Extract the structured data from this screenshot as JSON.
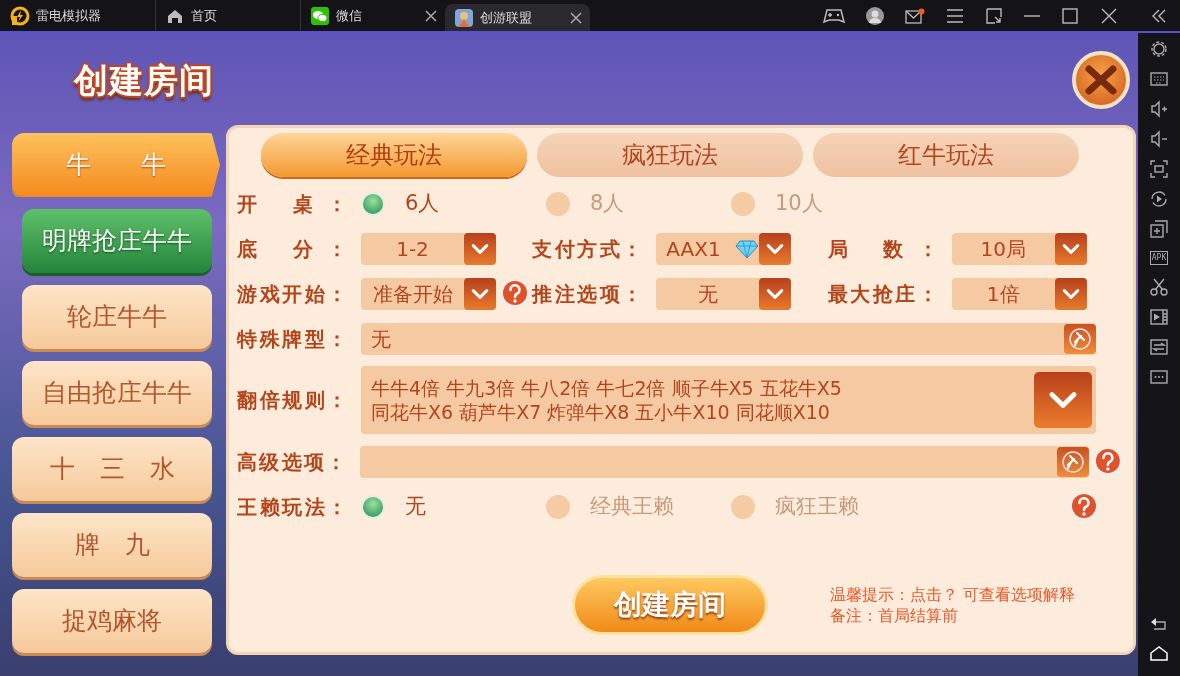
{
  "titlebar": {
    "app_name": "雷电模拟器",
    "mail_unread": true,
    "tabs": [
      {
        "label": "首页",
        "kind": "home",
        "selected": false,
        "closable": false
      },
      {
        "label": "微信",
        "kind": "chat",
        "selected": false,
        "closable": true
      },
      {
        "label": "创游联盟",
        "kind": "game",
        "selected": true,
        "closable": true
      }
    ]
  },
  "side_tools": [
    {
      "kind": "settings"
    },
    {
      "kind": "keyboard"
    },
    {
      "kind": "volup"
    },
    {
      "kind": "voldown"
    },
    {
      "kind": "screen"
    },
    {
      "kind": "rotate"
    },
    {
      "kind": "addwin"
    },
    {
      "kind": "apk",
      "label": "APK"
    },
    {
      "kind": "cut"
    },
    {
      "kind": "video"
    },
    {
      "kind": "sync"
    },
    {
      "kind": "more"
    },
    {
      "kind": "gap"
    },
    {
      "kind": "back"
    },
    {
      "kind": "home"
    }
  ],
  "dialog": {
    "title": "创建房间"
  },
  "games": [
    {
      "label": "牛　　牛",
      "selected": true,
      "children": [
        {
          "label": "明牌抢庄牛牛",
          "selected": true
        },
        {
          "label": "轮庄牛牛",
          "selected": false
        },
        {
          "label": "自由抢庄牛牛",
          "selected": false
        }
      ]
    },
    {
      "label": "十　三　水",
      "selected": false
    },
    {
      "label": "牌　九",
      "selected": false
    },
    {
      "label": "捉鸡麻将",
      "selected": false
    }
  ],
  "mode_tabs": [
    {
      "label": "经典玩法",
      "selected": true
    },
    {
      "label": "疯狂玩法",
      "selected": false
    },
    {
      "label": "红牛玩法",
      "selected": false
    }
  ],
  "seat_row": {
    "label": "开 桌：",
    "options": [
      {
        "label": "6人",
        "selected": true
      },
      {
        "label": "8人",
        "selected": false
      },
      {
        "label": "10人",
        "selected": false
      }
    ]
  },
  "select_rows": [
    [
      {
        "label": "底 分：",
        "value": "1-2",
        "kind": "plain"
      },
      {
        "label": "支付方式：",
        "value": "AAX1",
        "kind": "diamond"
      },
      {
        "label": "局 数：",
        "value": "10局",
        "kind": "plain"
      }
    ],
    [
      {
        "label": "游戏开始：",
        "value": "准备开始",
        "kind": "help"
      },
      {
        "label": "推注选项：",
        "value": "无",
        "kind": "plain"
      },
      {
        "label": "最大抢庄：",
        "value": "1倍",
        "kind": "plain"
      }
    ]
  ],
  "special": {
    "label": "特殊牌型：",
    "value": "无"
  },
  "double": {
    "label": "翻倍规则：",
    "lines": [
      "牛牛4倍 牛九3倍 牛八2倍 牛七2倍 顺子牛X5 五花牛X5",
      "同花牛X6 葫芦牛X7 炸弹牛X8 五小牛X10 同花顺X10"
    ]
  },
  "advanced": {
    "label": "高级选项："
  },
  "wild": {
    "label": "王赖玩法：",
    "options": [
      {
        "label": "无",
        "selected": true
      },
      {
        "label": "经典王赖",
        "selected": false
      },
      {
        "label": "疯狂王赖",
        "selected": false
      }
    ]
  },
  "create_button": "创建房间",
  "tips": [
    "温馨提示：点击？ 可查看选项解释",
    "备注：首局结算前"
  ]
}
